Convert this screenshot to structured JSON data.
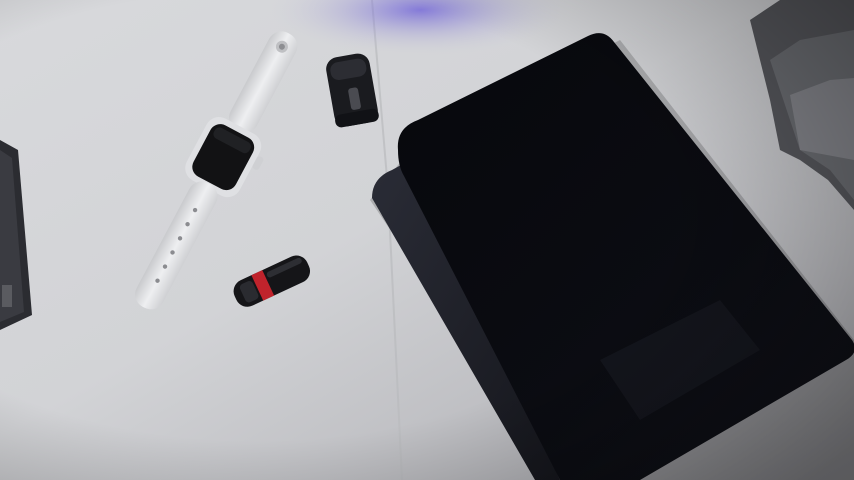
{
  "scene": {
    "kind": "photo",
    "objects": [
      "desk-surface",
      "smartwatch",
      "usb-flash-drive",
      "wireless-microphone",
      "tablet",
      "laptop-edge",
      "keyboard-corner"
    ],
    "colors": {
      "desk": "#dcdcdf",
      "desk_shadow": "#8e8e95",
      "purple_light": "#6a5cd9",
      "watch_band": "#e4e5e8",
      "watch_screen": "#121214",
      "usb_red": "#c0232c",
      "tablet_body": "#0a0b10"
    }
  }
}
